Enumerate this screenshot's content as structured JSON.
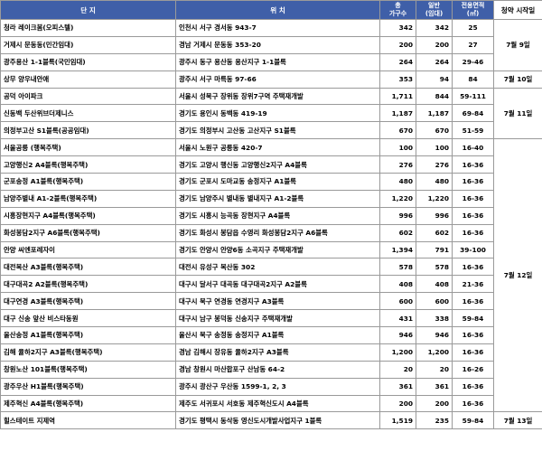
{
  "headers": {
    "complex": "단 지",
    "location": "위 치",
    "total_units_top": "총",
    "total_units_bottom": "가구수",
    "general_top": "일반",
    "general_bottom": "(임대)",
    "area_top": "전용면적",
    "area_bottom": "(㎡)",
    "date": "청약 시작일"
  },
  "rows": [
    {
      "complex": "청라 레이크봄(오피스텔)",
      "location": "인천시 서구 경서동 943-7",
      "total": "342",
      "general": "342",
      "area": "25"
    },
    {
      "complex": "거제시 문동동(민간임대)",
      "location": "경남 거제시 문동동 353-20",
      "total": "200",
      "general": "200",
      "area": "27"
    },
    {
      "complex": "광주용산 1-1블록(국민임대)",
      "location": "광주시 동구 용산동 용산지구 1-1블록",
      "total": "264",
      "general": "264",
      "area": "29-46"
    },
    {
      "complex": "상무 양우내안애",
      "location": "광주시 서구 마륵동 97-66",
      "total": "353",
      "general": "94",
      "area": "84"
    },
    {
      "complex": "공덕 아이파크",
      "location": "서울시 성북구 장위동 장위7구역 주택재개발",
      "total": "1,711",
      "general": "844",
      "area": "59-111"
    },
    {
      "complex": "신동백 두산위브더제니스",
      "location": "경기도 용인시 동백동 419-19",
      "total": "1,187",
      "general": "1,187",
      "area": "69-84"
    },
    {
      "complex": "의정부고산 S1블록(공공임대)",
      "location": "경기도 의정부시 고산동 고산지구 S1블록",
      "total": "670",
      "general": "670",
      "area": "51-59"
    },
    {
      "complex": "서울공릉 (행복주택)",
      "location": "서울시 노원구 공릉동 420-7",
      "total": "100",
      "general": "100",
      "area": "16-40"
    },
    {
      "complex": "고양행신2 A4블록(행복주택)",
      "location": "경기도 고양시 행신동 고양행신2지구 A4블록",
      "total": "276",
      "general": "276",
      "area": "16-36"
    },
    {
      "complex": "군포송정 A1블록(행복주택)",
      "location": "경기도 군포시 도마교동 송정지구 A1블록",
      "total": "480",
      "general": "480",
      "area": "16-36"
    },
    {
      "complex": "남양주별내 A1-2블록(행복주택)",
      "location": "경기도 남양주시 별내동 별내지구 A1-2블록",
      "total": "1,220",
      "general": "1,220",
      "area": "16-36"
    },
    {
      "complex": "시흥장현지구 A4블록(행복주택)",
      "location": "경기도 시흥시 능곡동 장현지구 A4블록",
      "total": "996",
      "general": "996",
      "area": "16-36"
    },
    {
      "complex": "화성봉담2지구 A6블록(행복주택)",
      "location": "경기도 화성시 봉담읍 수영리 화성봉담2지구 A6블록",
      "total": "602",
      "general": "602",
      "area": "16-36"
    },
    {
      "complex": "안양 씨엔포레자이",
      "location": "경기도 안양시 안양6동 소곡지구 주택재개발",
      "total": "1,394",
      "general": "791",
      "area": "39-100"
    },
    {
      "complex": "대전복산 A3블록(행복주택)",
      "location": "대전시 유성구 복산동 302",
      "total": "578",
      "general": "578",
      "area": "16-36"
    },
    {
      "complex": "대구대곡2 A2블록(행복주택)",
      "location": "대구시 달서구 대곡동 대구대곡2지구 A2블록",
      "total": "408",
      "general": "408",
      "area": "21-36"
    },
    {
      "complex": "대구연경 A3블록(행복주택)",
      "location": "대구시 북구 연경동 연경지구 A3블록",
      "total": "600",
      "general": "600",
      "area": "16-36"
    },
    {
      "complex": "대구 신송 앞산 비스타동원",
      "location": "대구시 남구 봉덕동 신송지구 주택재개발",
      "total": "431",
      "general": "338",
      "area": "59-84"
    },
    {
      "complex": "울산송정 A1블록(행복주택)",
      "location": "울산시 북구 송정동 송정지구 A1블록",
      "total": "946",
      "general": "946",
      "area": "16-36"
    },
    {
      "complex": "김해 율하2지구 A3블록(행복주택)",
      "location": "경남 김해시 장유동 율하2지구 A3블록",
      "total": "1,200",
      "general": "1,200",
      "area": "16-36"
    },
    {
      "complex": "창원노산 101블록(행복주택)",
      "location": "경남 창원시 마산합포구 산남동 64-2",
      "total": "20",
      "general": "20",
      "area": "16-26"
    },
    {
      "complex": "광주우산 H1블록(행복주택)",
      "location": "광주시 광산구 우산동 1599-1, 2, 3",
      "total": "361",
      "general": "361",
      "area": "16-36"
    },
    {
      "complex": "제주혁신 A4블록(행복주택)",
      "location": "제주도 서귀포시 서호동 제주혁신도시 A4블록",
      "total": "200",
      "general": "200",
      "area": "16-36"
    },
    {
      "complex": "힐스테이트 지제역",
      "location": "경기도 평택시 동삭동 영신도시개발사업지구 1블록",
      "total": "1,519",
      "general": "235",
      "area": "59-84"
    }
  ],
  "dates": {
    "jul9": "7월 9일",
    "jul10": "7월 10일",
    "jul11": "7월 11일",
    "jul12": "7월 12일",
    "jul13": "7월 13일"
  }
}
